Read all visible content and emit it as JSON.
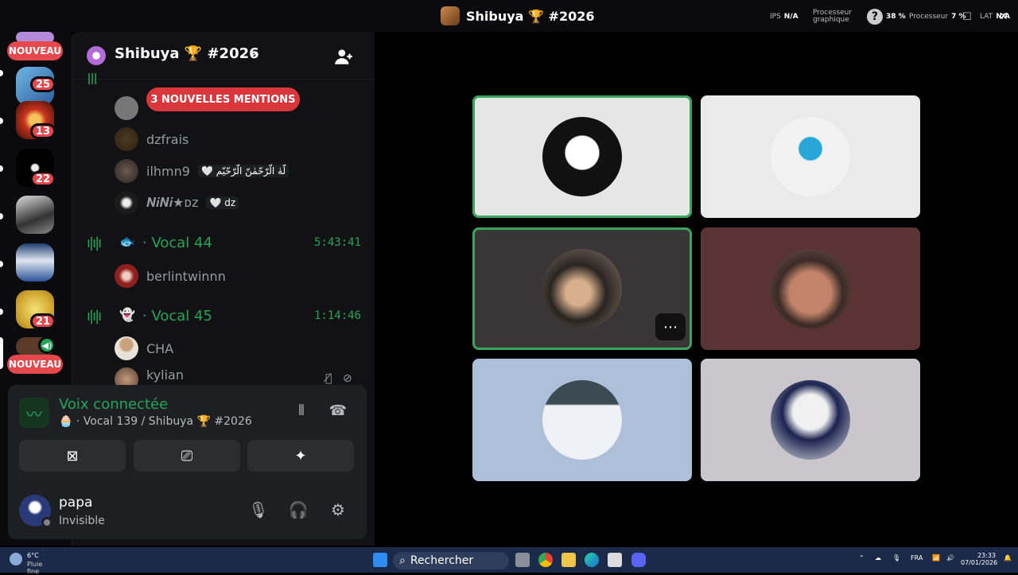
{
  "window": {
    "title": "Shibuya 🏆 #2026",
    "stats": {
      "ips_label": "IPS",
      "ips_value": "N/A",
      "gpu_label": "Processeur graphique",
      "help_pct": "38 %",
      "cpu_label": "Processeur",
      "cpu_value": "7 %",
      "lat_label": "LAT",
      "lat_value": "N/A"
    }
  },
  "rail": {
    "badges": [
      "25",
      "13",
      "22",
      "21"
    ],
    "new_label": "NOUVEAU"
  },
  "server": {
    "name": "Shibuya 🏆 #2026",
    "mentions_pill": "3 NOUVELLES MENTIONS"
  },
  "channels": [
    {
      "name": "Vocal 44",
      "duration": "5:43:41",
      "members": [
        "berlintwinnn"
      ]
    },
    {
      "name": "Vocal 45",
      "duration": "1:14:46",
      "members": [
        "CHA",
        "kylian"
      ]
    }
  ],
  "prev_members": [
    {
      "name": "dzfrais",
      "tag": ""
    },
    {
      "name": "ilhmn9",
      "tag": "🤍 لّهٰ الّرّحّمٰنّ الّرّحّيّم"
    },
    {
      "name": "𝑵𝒊𝑵𝒊★ᴅᴢ",
      "tag": "🤍 dz"
    }
  ],
  "voice": {
    "status": "Voix connectée",
    "channel_path": "· Vocal 139 / Shibuya 🏆 #2026"
  },
  "user": {
    "name": "papa",
    "status": "Invisible"
  },
  "tiles": [
    {
      "bg": "#e6e6e6",
      "speaking": true,
      "avatar": "adidas-hoodie"
    },
    {
      "bg": "#eaeaea",
      "speaking": false,
      "avatar": "blue-ninja"
    },
    {
      "bg": "#3a3537",
      "speaking": true,
      "avatar": "curly-hair"
    },
    {
      "bg": "#5a3434",
      "speaking": false,
      "avatar": "man-face"
    },
    {
      "bg": "#aebfda",
      "speaking": false,
      "avatar": "snow-scene"
    },
    {
      "bg": "#c9c6cc",
      "speaking": false,
      "avatar": "anime-skull"
    }
  ],
  "taskbar": {
    "temp": "6°C",
    "weather_desc": "Pluie fine",
    "search_label": "Rechercher",
    "lang": "FRA",
    "time": "23:33",
    "date": "07/01/2026"
  }
}
